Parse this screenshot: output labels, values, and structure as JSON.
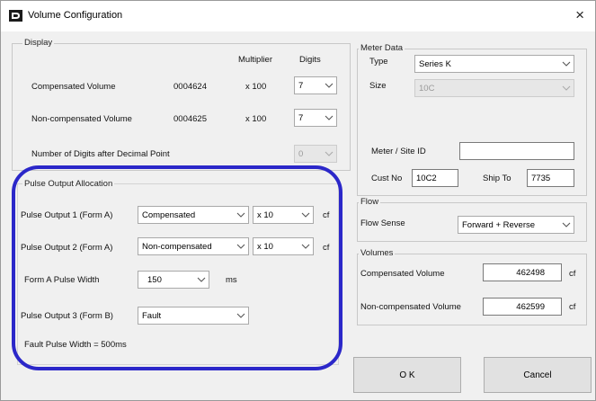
{
  "window": {
    "title": "Volume Configuration",
    "close_glyph": "×",
    "app_icon": "app-logo-icon"
  },
  "display": {
    "title": "Display",
    "col_multiplier": "Multiplier",
    "col_digits": "Digits",
    "rows": [
      {
        "label": "Compensated Volume",
        "value": "0004624",
        "multiplier": "x 100",
        "digits": "7"
      },
      {
        "label": "Non-compensated Volume",
        "value": "0004625",
        "multiplier": "x 100",
        "digits": "7"
      }
    ],
    "decimal_label": "Number of Digits after Decimal Point",
    "decimal_value": "0"
  },
  "pulse": {
    "title": "Pulse Output Allocation",
    "output1_label": "Pulse Output 1 (Form A)",
    "output1_value": "Compensated",
    "output1_mult": "x 10",
    "output1_unit": "cf",
    "output2_label": "Pulse Output 2 (Form A)",
    "output2_value": "Non-compensated",
    "output2_mult": "x 10",
    "output2_unit": "cf",
    "width_label": "Form A Pulse Width",
    "width_value": "150",
    "width_unit": "ms",
    "output3_label": "Pulse Output 3 (Form B)",
    "output3_value": "Fault",
    "fault_note": "Fault Pulse Width = 500ms"
  },
  "meter": {
    "title": "Meter Data",
    "type_label": "Type",
    "type_value": "Series K",
    "size_label": "Size",
    "size_value": "10C",
    "site_label": "Meter / Site ID",
    "site_value": "",
    "cust_label": "Cust No",
    "cust_value": "10C2",
    "ship_label": "Ship To",
    "ship_value": "7735"
  },
  "flow": {
    "title": "Flow",
    "sense_label": "Flow Sense",
    "sense_value": "Forward + Reverse"
  },
  "volumes": {
    "title": "Volumes",
    "comp_label": "Compensated Volume",
    "comp_value": "462498",
    "comp_unit": "cf",
    "noncomp_label": "Non-compensated Volume",
    "noncomp_value": "462599",
    "noncomp_unit": "cf"
  },
  "buttons": {
    "ok": "O K",
    "cancel": "Cancel"
  },
  "colors": {
    "highlight": "#2b27c9",
    "background": "#f0f0f0"
  }
}
